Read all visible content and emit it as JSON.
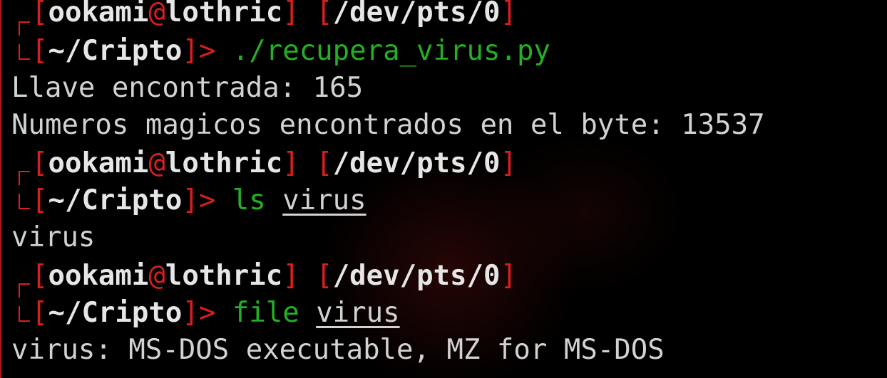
{
  "colors": {
    "background": "#000000",
    "prompt_bracket": "#d81e1e",
    "prompt_text": "#e6e6e6",
    "command": "#24b024",
    "output": "#d2d2d2"
  },
  "prompt": {
    "user": "ookami",
    "at": "@",
    "host": "lothric",
    "tty": "/dev/pts/0",
    "cwd": "~/Cripto",
    "arrow": ">"
  },
  "entries": [
    {
      "command": "./recupera_virus.py",
      "output": [
        "Llave encontrada: 165",
        "Numeros magicos encontrados en el byte: 13537"
      ]
    },
    {
      "command_name": "ls",
      "command_arg": "virus",
      "output": [
        "virus"
      ]
    },
    {
      "command_name": "file",
      "command_arg": "virus",
      "output": [
        "virus: MS-DOS executable, MZ for MS-DOS"
      ]
    }
  ]
}
